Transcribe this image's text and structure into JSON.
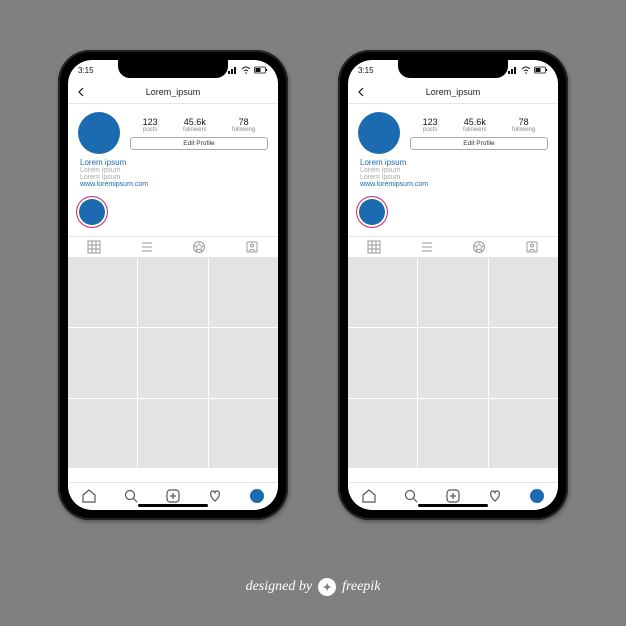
{
  "status": {
    "time": "3:15",
    "signal_icon": "signal",
    "wifi_icon": "wifi",
    "battery_icon": "battery"
  },
  "topbar": {
    "back_icon": "chevron-left",
    "title": "Lorem_ipsum"
  },
  "profile": {
    "avatar_color": "#1c6bb0",
    "stats": [
      {
        "value": "123",
        "label": "posts"
      },
      {
        "value": "45.6k",
        "label": "followers"
      },
      {
        "value": "78",
        "label": "following"
      }
    ],
    "edit_label": "Edit Profile"
  },
  "bio": {
    "name": "Lorem ipsum",
    "line1": "Lorem ipsum",
    "line2": "Lorem ipsum",
    "link": "www.loremipsum.com"
  },
  "highlight": {
    "avatar_color": "#1c6bb0"
  },
  "tabs": {
    "grid_icon": "grid",
    "list_icon": "list",
    "tagged_icon": "star-badge",
    "saved_icon": "tag-person"
  },
  "grid": {
    "cells": 9
  },
  "navbar": {
    "home_icon": "home",
    "search_icon": "search",
    "add_icon": "plus-square",
    "activity_icon": "heart",
    "profile_icon": "avatar"
  },
  "attribution": {
    "prefix": "designed by",
    "brand": "freepik",
    "logo": "fp"
  }
}
